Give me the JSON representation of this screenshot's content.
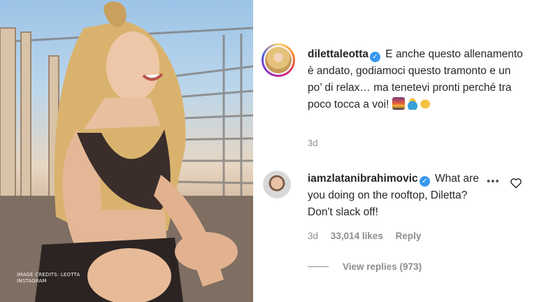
{
  "photo": {
    "credit_line1": "IMAGE CREDITS: LEOTTA",
    "credit_line2": "INSTAGRAM"
  },
  "post": {
    "username": "dilettaleotta",
    "caption": "E anche questo allenamento è andato, godiamoci questo tramonto e un po’ di relax… ma tenetevi pronti perché tra poco tocca a voi!",
    "emojis": [
      "sunset-emoji",
      "woman-emoji",
      "flexed-biceps-emoji"
    ],
    "time": "3d"
  },
  "comment": {
    "username": "iamzlatanibrahimovic",
    "text": "What are you doing on the rooftop, Diletta? Don't slack off!",
    "time": "3d",
    "likes": "33,014 likes",
    "reply_label": "Reply",
    "more_icon": "more-options-icon",
    "like_icon": "heart-icon",
    "view_replies": "View replies (973)"
  },
  "colors": {
    "verified": "#3897f0",
    "muted": "#8e8e8e",
    "text": "#262626"
  }
}
